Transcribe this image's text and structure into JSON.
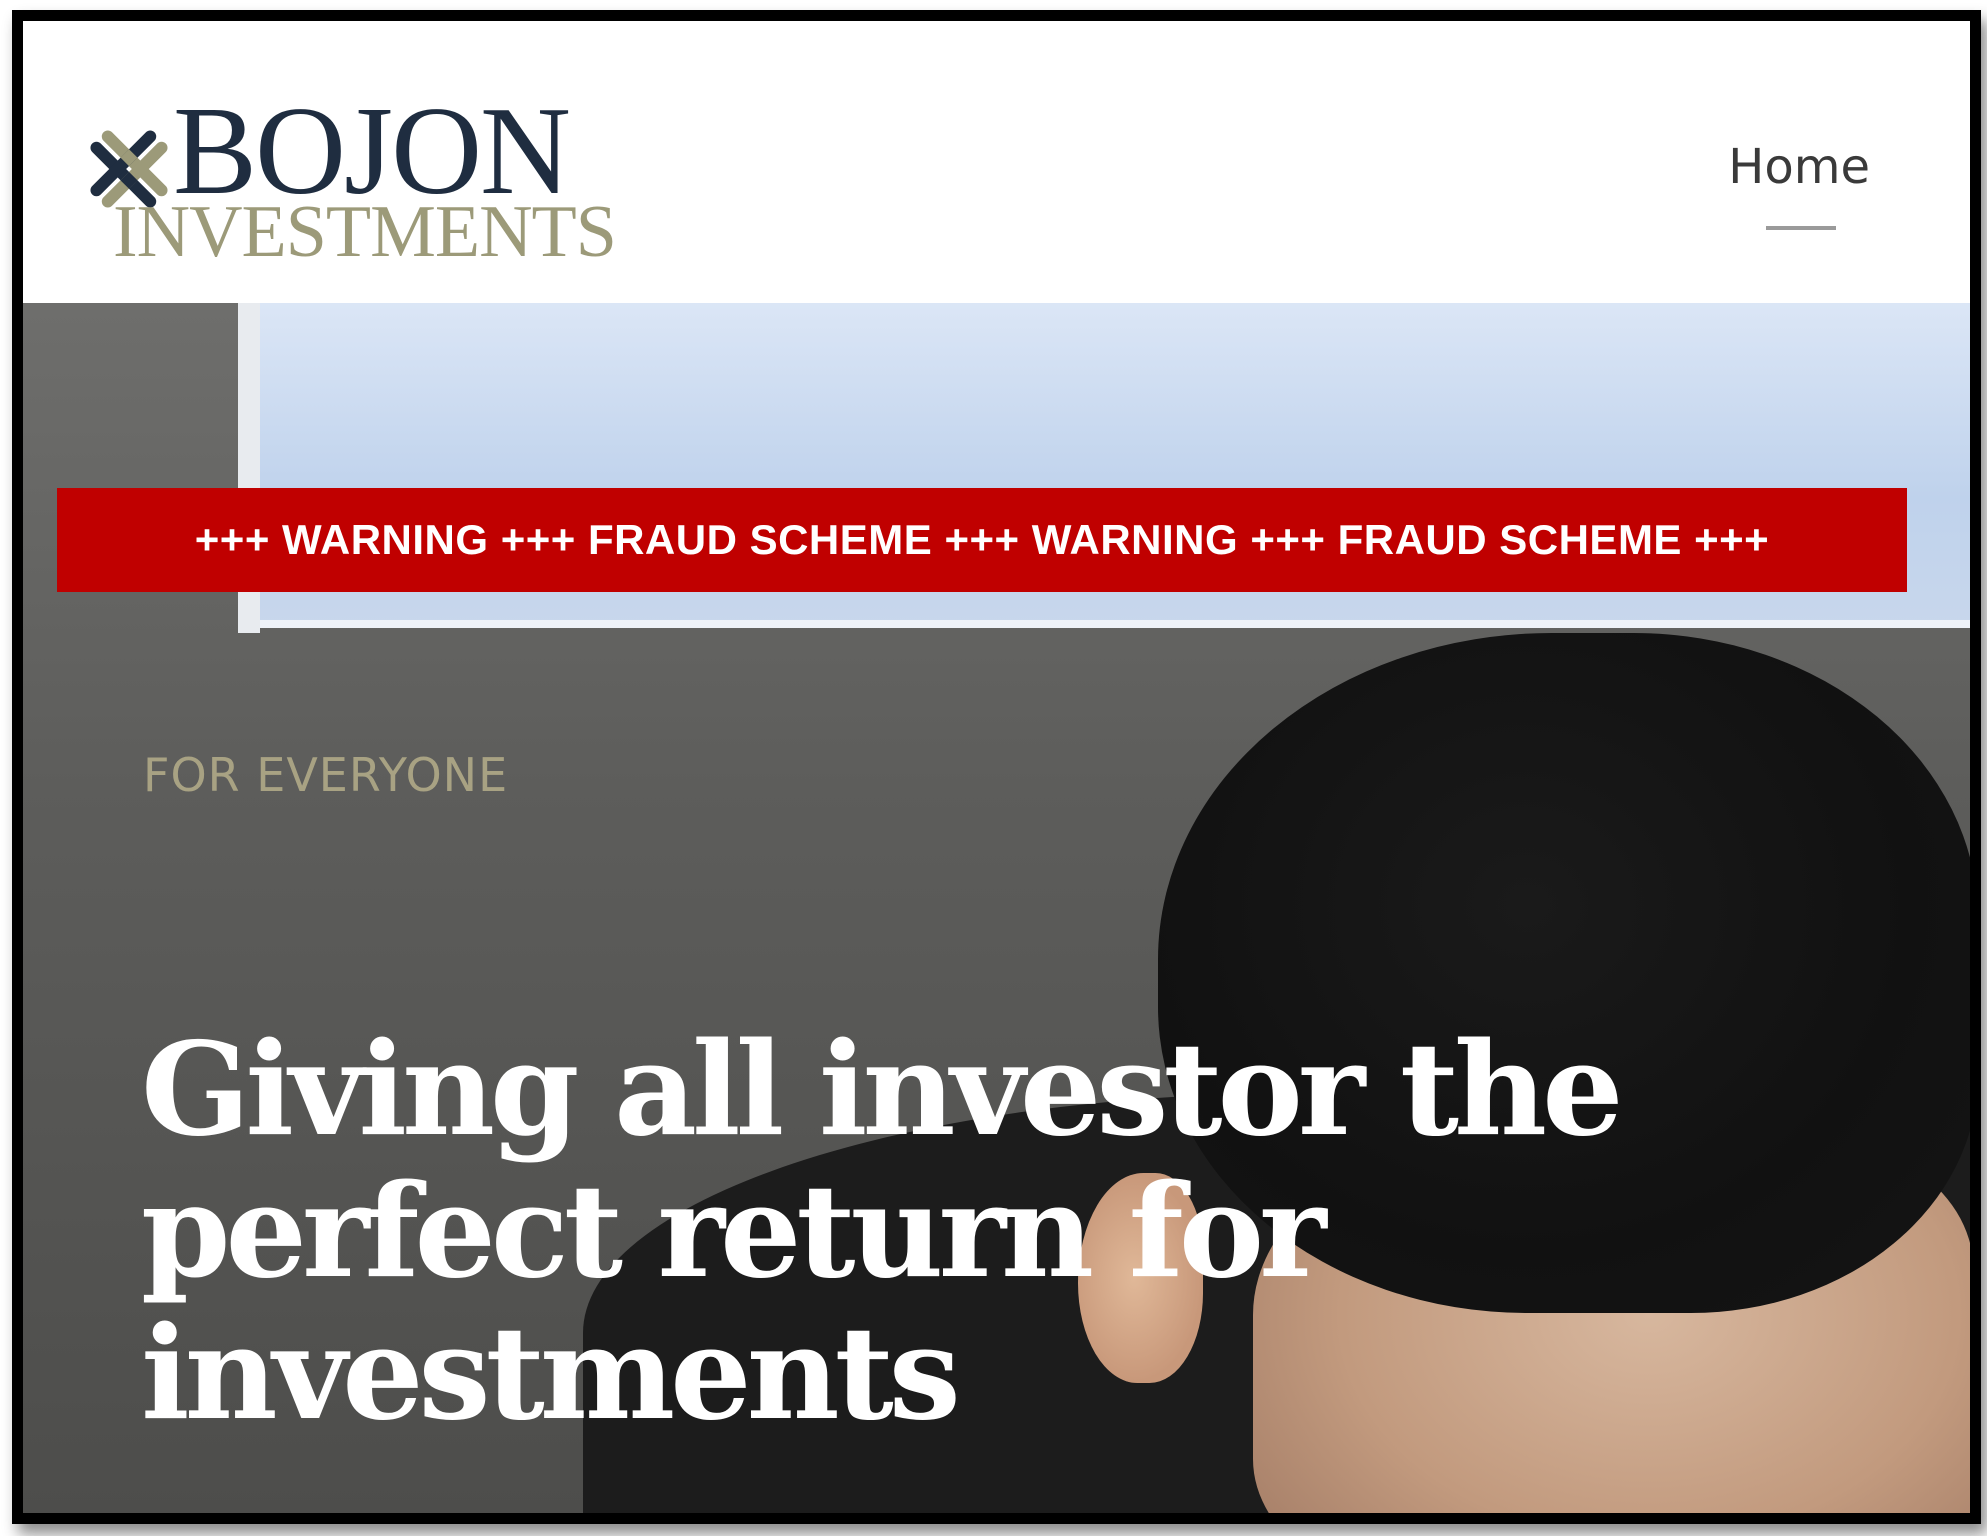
{
  "header": {
    "logo": {
      "line1": "BOJON",
      "line2": "INVESTMENTS",
      "mark_icon": "interwoven-lattice-icon",
      "colors": {
        "navy": "#1f2d40",
        "khaki": "#9c9a79"
      }
    },
    "nav": {
      "home_label": "Home"
    }
  },
  "banner": {
    "text": "+++ WARNING +++ FRAUD SCHEME +++ WARNING +++ FRAUD SCHEME +++",
    "color": "#c00000"
  },
  "hero": {
    "eyebrow": "FOR EVERYONE",
    "headline_lines": [
      "Giving all investor the",
      "perfect return for",
      "investments"
    ],
    "eyebrow_color": "#a8a283"
  }
}
